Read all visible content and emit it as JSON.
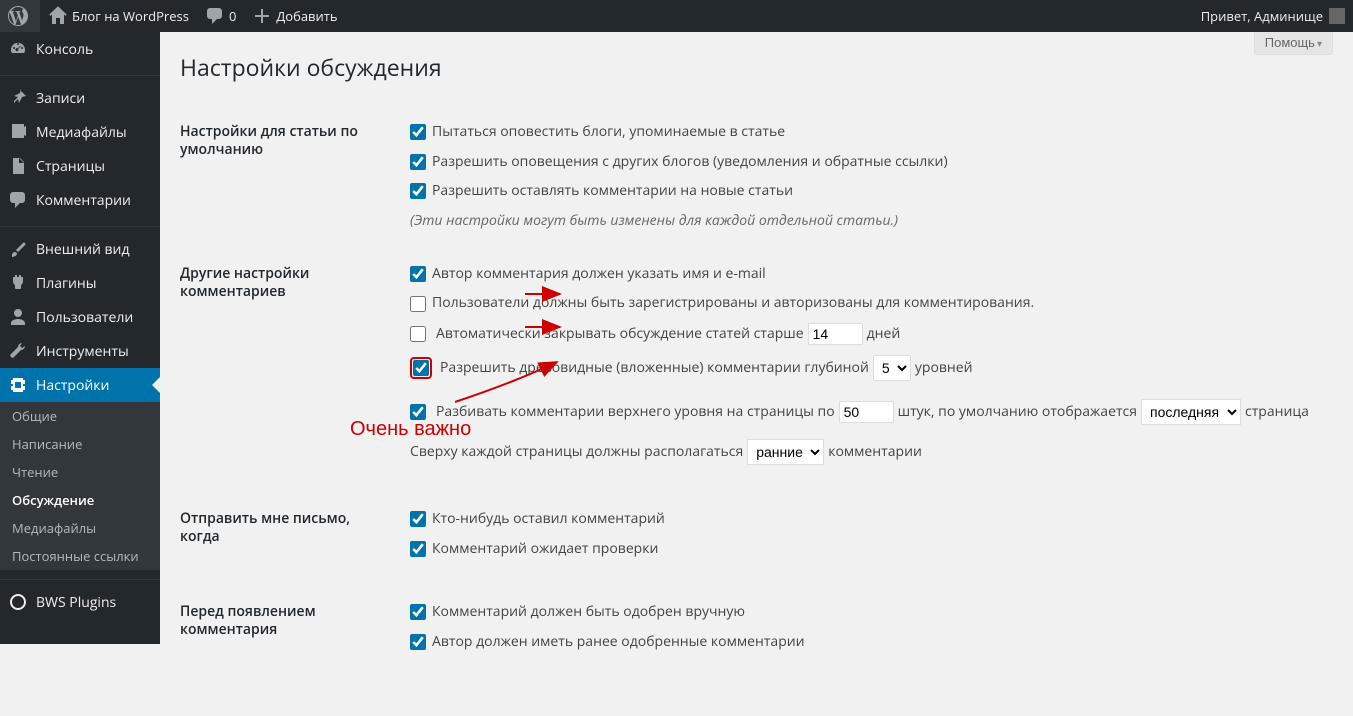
{
  "adminbar": {
    "site_name": "Блог на WordPress",
    "comments_count": "0",
    "add_new": "Добавить",
    "greeting": "Привет,",
    "user": "Админище"
  },
  "menu": {
    "dashboard": "Консоль",
    "posts": "Записи",
    "media": "Медиафайлы",
    "pages": "Страницы",
    "comments": "Комментарии",
    "appearance": "Внешний вид",
    "plugins": "Плагины",
    "users": "Пользователи",
    "tools": "Инструменты",
    "settings": "Настройки",
    "bws": "BWS Plugins"
  },
  "submenu": {
    "general": "Общие",
    "writing": "Написание",
    "reading": "Чтение",
    "discussion": "Обсуждение",
    "media": "Медиафайлы",
    "permalinks": "Постоянные ссылки"
  },
  "help_btn": "Помощь",
  "page_title": "Настройки обсуждения",
  "s1": {
    "heading": "Настройки для статьи по умолчанию",
    "c1": "Пытаться оповестить блоги, упоминаемые в статье",
    "c2": "Разрешить оповещения с других блогов (уведомления и обратные ссылки)",
    "c3": "Разрешить оставлять комментарии на новые статьи",
    "desc": "(Эти настройки могут быть изменены для каждой отдельной статьи.)"
  },
  "s2": {
    "heading": "Другие настройки комментариев",
    "c1": "Автор комментария должен указать имя и e-mail",
    "c2": "Пользователи должны быть зарегистрированы и авторизованы для комментирования.",
    "c3a": "Автоматически закрывать обсуждение статей старше",
    "c3_val": "14",
    "c3b": "дней",
    "c4a": "Разрешить древовидные (вложенные) комментарии глубиной",
    "c4_val": "5",
    "c4b": "уровней",
    "c5a": "Разбивать комментарии верхнего уровня на страницы по",
    "c5_val": "50",
    "c5b": "штук, по умолчанию отображается",
    "c5_sel": "последняя",
    "c5c": "страница",
    "c6a": "Сверху каждой страницы должны располагаться",
    "c6_sel": "ранние",
    "c6b": "комментарии"
  },
  "s3": {
    "heading": "Отправить мне письмо, когда",
    "c1": "Кто-нибудь оставил комментарий",
    "c2": "Комментарий ожидает проверки"
  },
  "s4": {
    "heading": "Перед появлением комментария",
    "c1": "Комментарий должен быть одобрен вручную",
    "c2": "Автор должен иметь ранее одобренные комментарии"
  },
  "annotation": "Очень важно"
}
